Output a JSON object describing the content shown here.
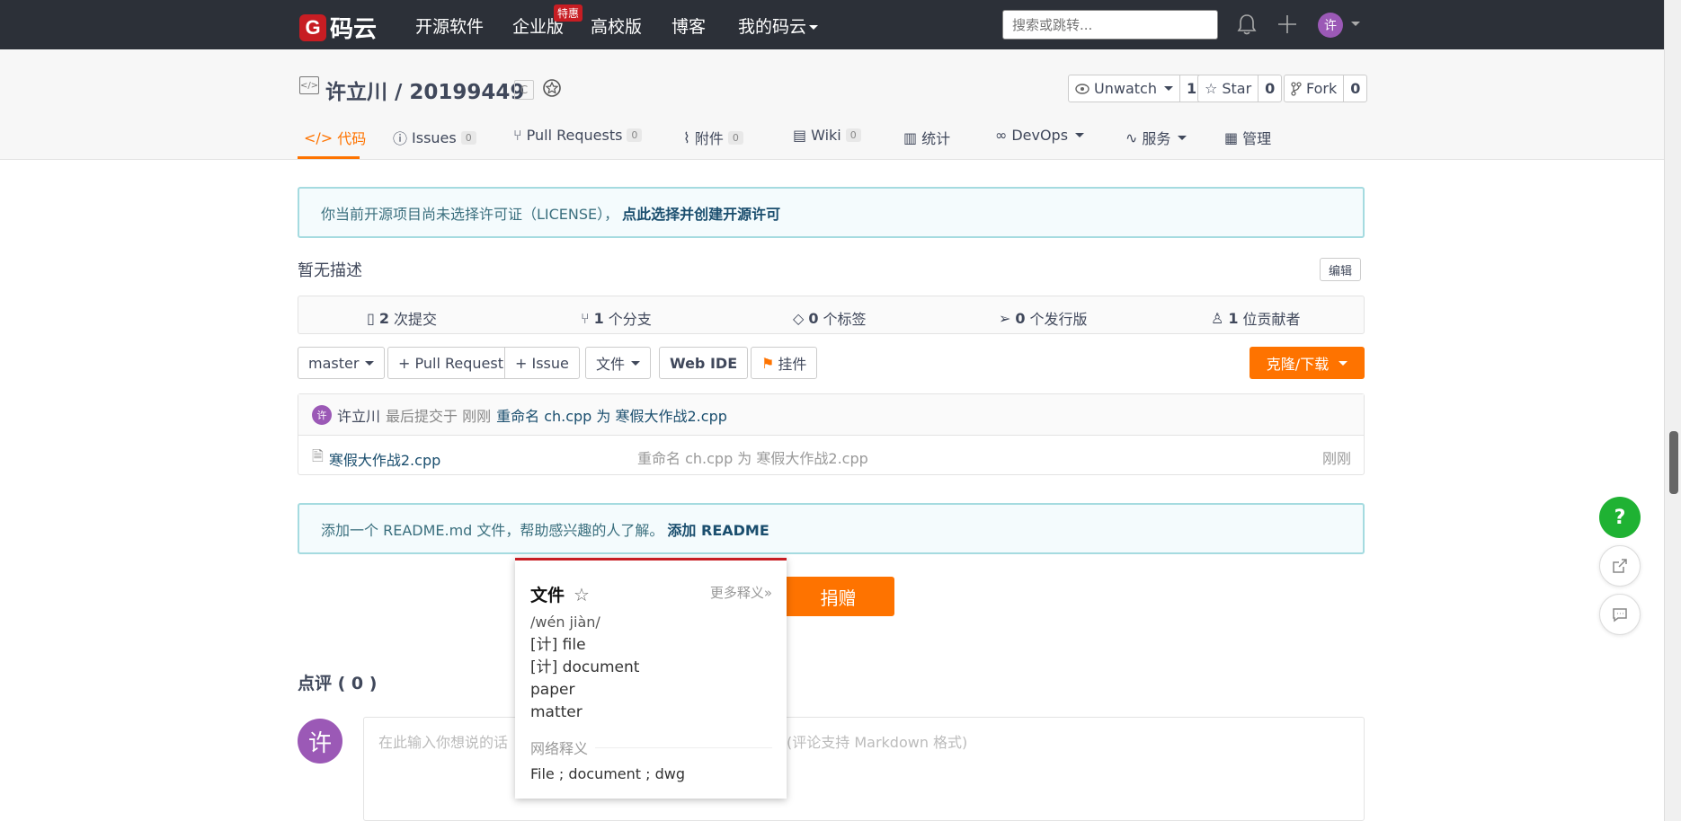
{
  "topnav": {
    "logo_letter": "G",
    "logo_text": "码云",
    "items": [
      "开源软件",
      "企业版",
      "高校版",
      "博客",
      "我的码云"
    ],
    "hot_badge": "特惠",
    "search_placeholder": "搜索或跳转...",
    "avatar_text": "许"
  },
  "repo": {
    "title": "许立川 / 20199449",
    "lang_badge": "C",
    "unwatch_label": "Unwatch",
    "unwatch_count": "1",
    "star_label": "Star",
    "star_count": "0",
    "fork_label": "Fork",
    "fork_count": "0"
  },
  "tabs": [
    {
      "label": "代码",
      "count": ""
    },
    {
      "label": "Issues",
      "count": "0"
    },
    {
      "label": "Pull Requests",
      "count": "0"
    },
    {
      "label": "附件",
      "count": "0"
    },
    {
      "label": "Wiki",
      "count": "0"
    },
    {
      "label": "统计",
      "count": ""
    },
    {
      "label": "DevOps",
      "count": ""
    },
    {
      "label": "服务",
      "count": ""
    },
    {
      "label": "管理",
      "count": ""
    }
  ],
  "license_banner": {
    "text": "你当前开源项目尚未选择许可证（LICENSE），",
    "link": "点此选择并创建开源许可"
  },
  "description": "暂无描述",
  "edit_label": "编辑",
  "stats": [
    {
      "count": "2",
      "label": "次提交"
    },
    {
      "count": "1",
      "label": "个分支"
    },
    {
      "count": "0",
      "label": "个标签"
    },
    {
      "count": "0",
      "label": "个发行版"
    },
    {
      "count": "1",
      "label": "位贡献者"
    }
  ],
  "toolbar": {
    "branch": "master",
    "pull_request": "+ Pull Request",
    "issue": "+ Issue",
    "file": "文件",
    "web_ide": "Web IDE",
    "widget": "挂件",
    "clone": "克隆/下载"
  },
  "last_commit": {
    "avatar": "许",
    "author": "许立川",
    "meta": "最后提交于 刚刚",
    "message": "重命名 ch.cpp 为 寒假大作战2.cpp"
  },
  "files": [
    {
      "name": "寒假大作战2.cpp",
      "commit": "重命名 ch.cpp 为 寒假大作战2.cpp",
      "time": "刚刚"
    }
  ],
  "readme_banner": {
    "text": "添加一个 README.md 文件，帮助感兴趣的人了解。",
    "link": "添加 README"
  },
  "donate_label": "捐赠",
  "comments": {
    "title": "点评 ( 0 )",
    "avatar": "许",
    "placeholder_left": "在此输入你想说的话",
    "placeholder_right": "(评论支持 Markdown 格式)"
  },
  "dictionary": {
    "word": "文件",
    "more": "更多释义»",
    "pinyin": "/wén jiàn/",
    "definitions": [
      "[计] file",
      "[计] document",
      "paper",
      "matter"
    ],
    "net_label": "网络释义",
    "net_def": "File ; document ; dwg"
  },
  "float": {
    "help": "?"
  },
  "colors": {
    "nav_bg": "#2c3038",
    "accent": "#fe7300",
    "brand_red": "#c71d23",
    "help_green": "#1fb233"
  }
}
